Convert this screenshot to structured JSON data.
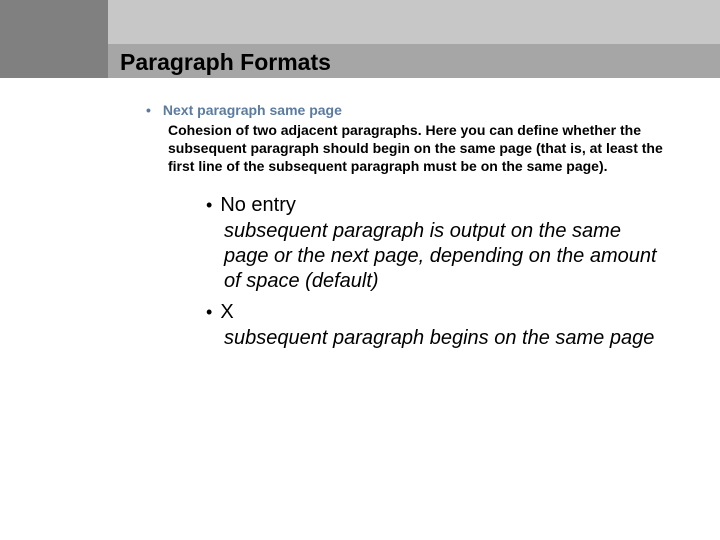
{
  "title": "Paragraph Formats",
  "item": {
    "heading": "Next paragraph same page",
    "body": "Cohesion of two adjacent paragraphs. Here you can define whether the subsequent paragraph should begin on the same page (that is, at least the first line of the subsequent paragraph must be on the same page).",
    "sub": [
      {
        "heading": "No entry",
        "body": "subsequent paragraph is output on the same page or the next page, depending on the amount of space (default)"
      },
      {
        "heading": "X",
        "body": "subsequent paragraph begins on the same page"
      }
    ]
  }
}
